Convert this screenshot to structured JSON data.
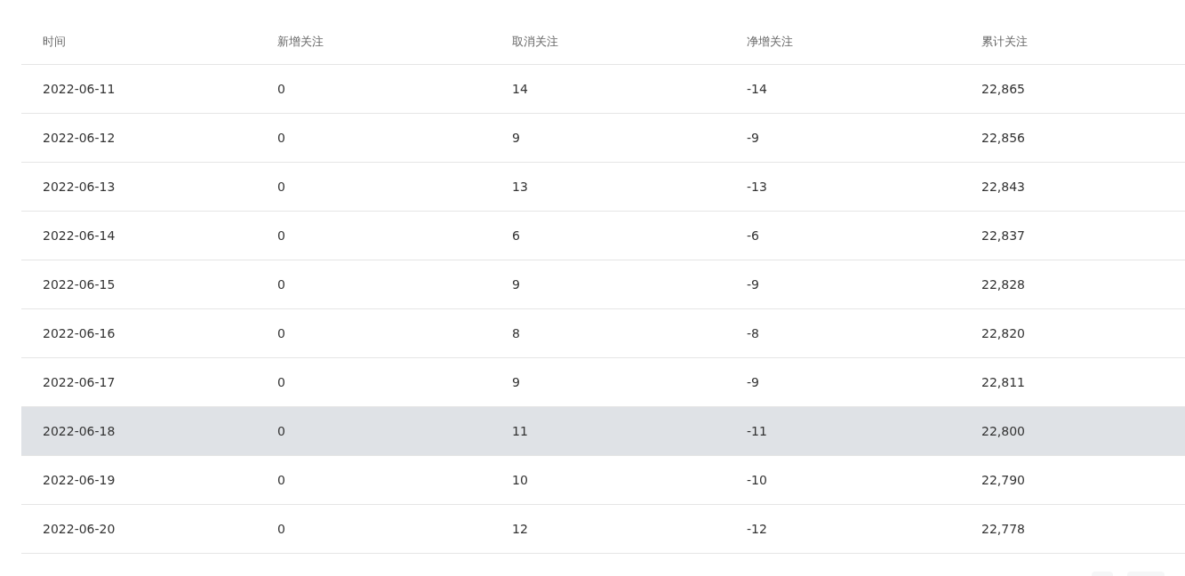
{
  "table": {
    "columns": [
      "时间",
      "新增关注",
      "取消关注",
      "净增关注",
      "累计关注"
    ],
    "rows": [
      {
        "cells": [
          "2022-06-11",
          "0",
          "14",
          "-14",
          "22,865"
        ],
        "highlighted": false
      },
      {
        "cells": [
          "2022-06-12",
          "0",
          "9",
          "-9",
          "22,856"
        ],
        "highlighted": false
      },
      {
        "cells": [
          "2022-06-13",
          "0",
          "13",
          "-13",
          "22,843"
        ],
        "highlighted": false
      },
      {
        "cells": [
          "2022-06-14",
          "0",
          "6",
          "-6",
          "22,837"
        ],
        "highlighted": false
      },
      {
        "cells": [
          "2022-06-15",
          "0",
          "9",
          "-9",
          "22,828"
        ],
        "highlighted": false
      },
      {
        "cells": [
          "2022-06-16",
          "0",
          "8",
          "-8",
          "22,820"
        ],
        "highlighted": false
      },
      {
        "cells": [
          "2022-06-17",
          "0",
          "9",
          "-9",
          "22,811"
        ],
        "highlighted": false
      },
      {
        "cells": [
          "2022-06-18",
          "0",
          "11",
          "-11",
          "22,800"
        ],
        "highlighted": true
      },
      {
        "cells": [
          "2022-06-19",
          "0",
          "10",
          "-10",
          "22,790"
        ],
        "highlighted": false
      },
      {
        "cells": [
          "2022-06-20",
          "0",
          "12",
          "-12",
          "22,778"
        ],
        "highlighted": false
      }
    ]
  }
}
